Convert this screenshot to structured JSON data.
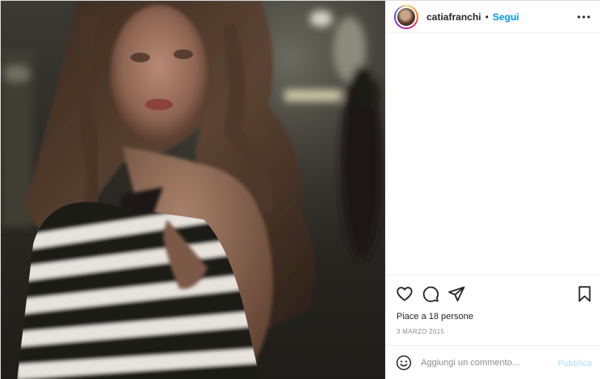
{
  "post": {
    "username": "catiafranchi",
    "separator": "•",
    "follow_label": "Segui",
    "likes_text": "Piace a 18 persone",
    "date": "3 MARZO 2015"
  },
  "comment_box": {
    "placeholder": "Aggiungi un commento...",
    "publish_label": "Pubblica"
  },
  "icons": {
    "more": "more-options-icon",
    "like": "heart-icon",
    "comment": "comment-icon",
    "share": "share-icon",
    "save": "bookmark-icon",
    "emoji": "emoji-icon"
  },
  "colors": {
    "accent": "#0095f6",
    "publish_disabled": "#b2dffc",
    "muted": "#8e8e8e",
    "border": "#efefef"
  }
}
